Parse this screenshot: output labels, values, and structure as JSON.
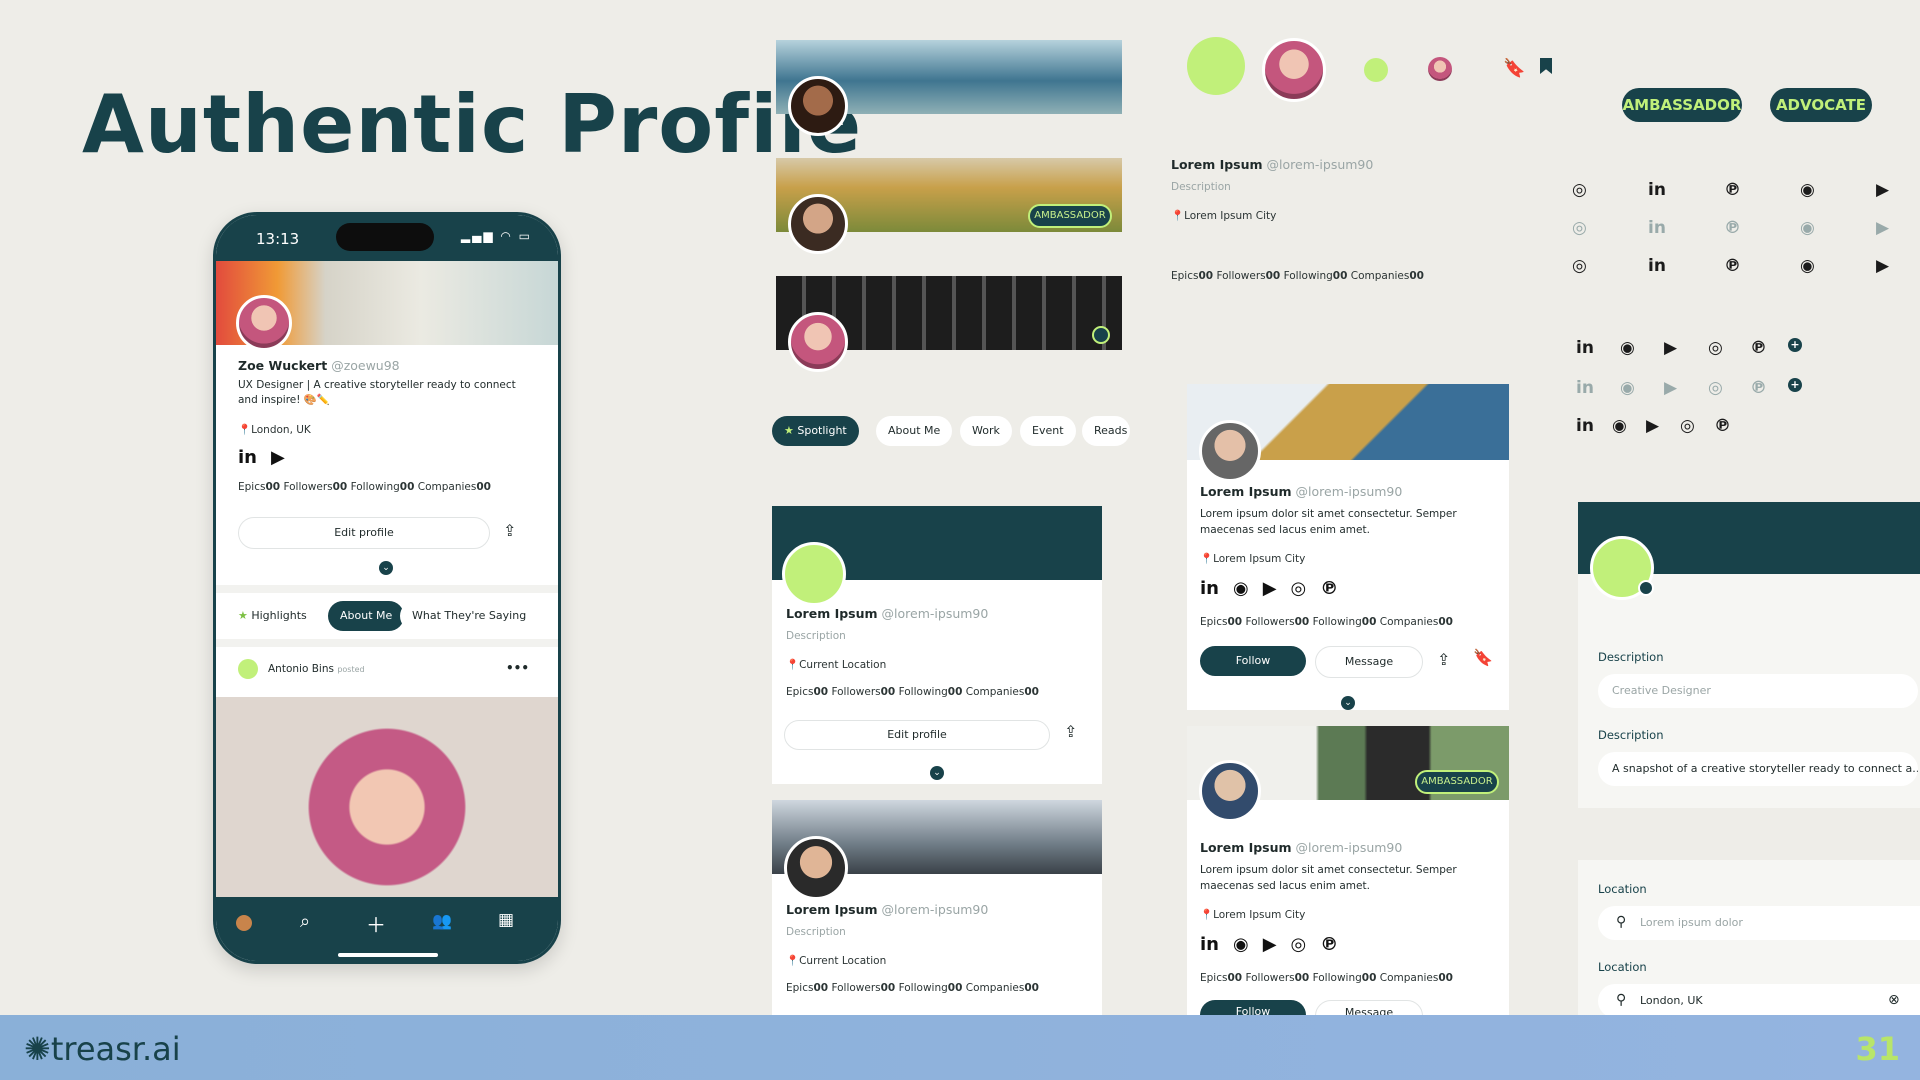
{
  "title": "Authentic Profile",
  "phone": {
    "time": "13:13",
    "name": "Zoe Wuckert",
    "handle": "@zoewu98",
    "bio": "UX Designer | A creative storyteller ready to connect and inspire! 🎨✏️",
    "location": "London, UK",
    "stats": {
      "epics_label": "Epics",
      "epics": "00",
      "followers_label": "Followers",
      "followers": "00",
      "following_label": "Following",
      "following": "00",
      "companies_label": "Companies",
      "companies": "00"
    },
    "edit_profile": "Edit profile",
    "tabs": [
      "Highlights",
      "About Me",
      "What They're Saying"
    ],
    "post_author": "Antonio Bins",
    "post_meta": "posted",
    "post_more": "•••"
  },
  "center_tabs": [
    "Spotlight",
    "About Me",
    "Work",
    "Event",
    "Reads"
  ],
  "badges": {
    "ambassador": "AMBASSADOR",
    "advocate": "ADVOCATE",
    "ambassador_small": "AMBASSADOR"
  },
  "top_card": {
    "name": "Lorem Ipsum",
    "handle": "@lorem-ipsum90",
    "description": "Description",
    "location": "Lorem Ipsum City"
  },
  "mid_card": {
    "name": "Lorem Ipsum",
    "handle": "@lorem-ipsum90",
    "description": "Description",
    "location": "Current Location",
    "edit_profile": "Edit profile"
  },
  "low_card": {
    "name": "Lorem Ipsum",
    "handle": "@lorem-ipsum90",
    "description": "Description",
    "location": "Current Location"
  },
  "right_card1": {
    "name": "Lorem Ipsum",
    "handle": "@lorem-ipsum90",
    "bio": "Lorem ipsum dolor sit amet consectetur. Semper maecenas sed lacus enim amet.",
    "location": "Lorem Ipsum City",
    "follow": "Follow",
    "message": "Message"
  },
  "right_card2": {
    "name": "Lorem Ipsum",
    "handle": "@lorem-ipsum90",
    "bio": "Lorem ipsum dolor sit amet consectetur. Semper maecenas sed lacus enim amet.",
    "location": "Lorem Ipsum City",
    "follow": "Follow",
    "message": "Message"
  },
  "stat_labels": {
    "epics": "Epics",
    "followers": "Followers",
    "following": "Following",
    "companies": "Companies",
    "value": "00"
  },
  "form": {
    "desc_label": "Description",
    "desc_placeholder": "Creative Designer",
    "desc2_label": "Description",
    "desc2_value": "A snapshot of a creative storyteller ready to connect a...",
    "loc_label": "Location",
    "loc_placeholder": "Lorem ipsum dolor",
    "loc2_label": "Location",
    "loc2_value": "London, UK"
  },
  "brand": "treasr.ai",
  "page_number": "31",
  "colors": {
    "primary": "#18424a",
    "accent": "#c1f07a",
    "background": "#eeede8"
  }
}
